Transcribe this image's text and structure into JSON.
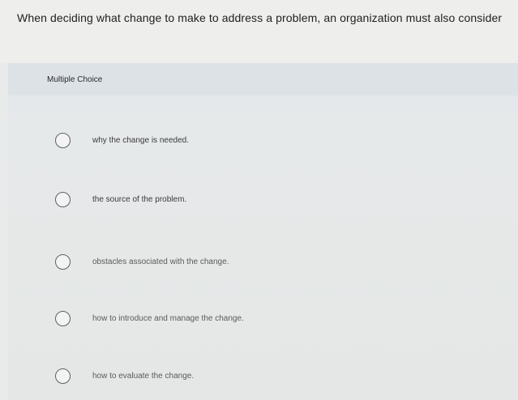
{
  "question": {
    "text": "When deciding what change to make to address a problem, an organization must also consider"
  },
  "multiple_choice": {
    "label": "Multiple Choice",
    "options": [
      {
        "label": "why the change is needed."
      },
      {
        "label": "the source of the problem."
      },
      {
        "label": "obstacles associated with the change."
      },
      {
        "label": "how to introduce and manage the change."
      },
      {
        "label": "how to evaluate the change."
      }
    ]
  }
}
